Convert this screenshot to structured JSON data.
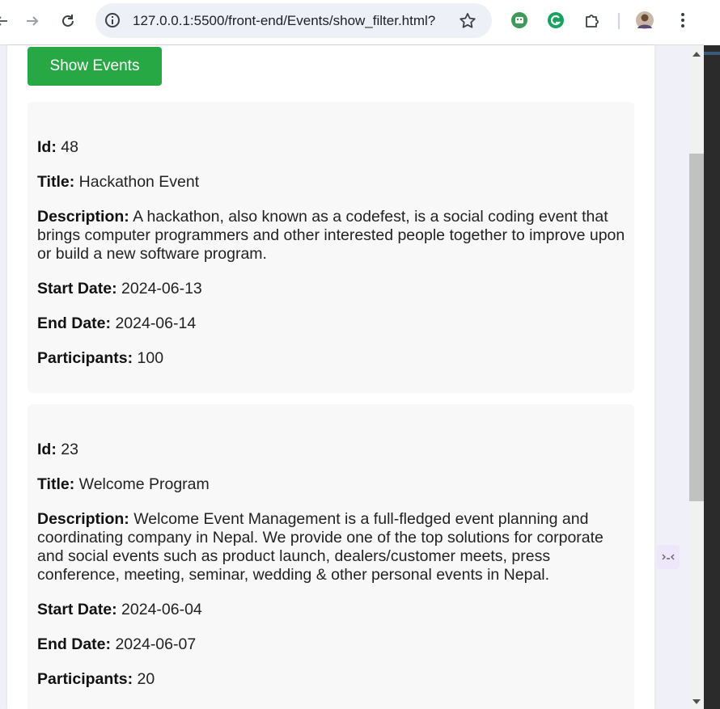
{
  "browser": {
    "url": "127.0.0.1:5500/front-end/Events/show_filter.html?"
  },
  "page": {
    "show_button_label": "Show Events",
    "labels": {
      "id": "Id:",
      "title": "Title:",
      "description": "Description:",
      "start_date": "Start Date:",
      "end_date": "End Date:",
      "participants": "Participants:"
    },
    "events": [
      {
        "id": "48",
        "title": "Hackathon Event",
        "description": "A hackathon, also known as a codefest, is a social coding event that brings computer programmers and other interested people together to improve upon or build a new software program.",
        "start_date": "2024-06-13",
        "end_date": "2024-06-14",
        "participants": "100"
      },
      {
        "id": "23",
        "title": "Welcome Program",
        "description": "Welcome Event Management is a full-fledged event planning and coordinating company in Nepal. We provide one of the top solutions for corporate and social events such as product launch, dealers/customer meets, press conference, meeting, seminar, wedding & other personal events in Nepal.",
        "start_date": "2024-06-04",
        "end_date": "2024-06-07",
        "participants": "20"
      }
    ]
  },
  "colors": {
    "button_green": "#28a745",
    "card_bg": "#f8f8f8"
  },
  "icons": [
    "back-arrow-icon",
    "forward-arrow-icon",
    "reload-icon",
    "info-icon",
    "star-icon",
    "extension-icon",
    "grammarly-icon",
    "puzzle-icon",
    "profile-avatar",
    "kebab-menu-icon"
  ]
}
